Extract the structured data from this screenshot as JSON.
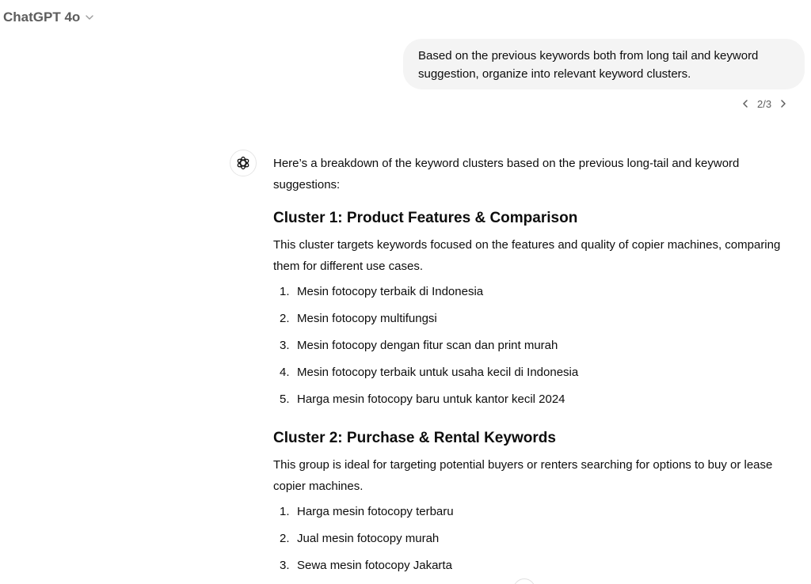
{
  "header": {
    "model_name": "ChatGPT 4o",
    "dropdown_icon": "chevron-down-icon"
  },
  "user_message": {
    "text": "Based on the previous keywords both from long tail and keyword suggestion, organize into relevant keyword clusters."
  },
  "pager": {
    "label": "2/3",
    "prev_icon": "chevron-left-icon",
    "next_icon": "chevron-right-icon"
  },
  "assistant": {
    "avatar_icon": "openai-logo-icon",
    "intro": "Here’s a breakdown of the keyword clusters based on the previous long-tail and keyword suggestions:",
    "clusters": [
      {
        "title": "Cluster 1: Product Features & Comparison",
        "description": "This cluster targets keywords focused on the features and quality of copier machines, comparing them for different use cases.",
        "items": [
          {
            "num": "1.",
            "text": "Mesin fotocopy terbaik di Indonesia"
          },
          {
            "num": "2.",
            "text": "Mesin fotocopy multifungsi"
          },
          {
            "num": "3.",
            "text": "Mesin fotocopy dengan fitur scan dan print murah"
          },
          {
            "num": "4.",
            "text": "Mesin fotocopy terbaik untuk usaha kecil di Indonesia"
          },
          {
            "num": "5.",
            "text": "Harga mesin fotocopy baru untuk kantor kecil 2024"
          }
        ]
      },
      {
        "title": "Cluster 2: Purchase & Rental Keywords",
        "description": "This group is ideal for targeting potential buyers or renters searching for options to buy or lease copier machines.",
        "items": [
          {
            "num": "1.",
            "text": "Harga mesin fotocopy terbaru"
          },
          {
            "num": "2.",
            "text": "Jual mesin fotocopy murah"
          },
          {
            "num": "3.",
            "text": "Sewa mesin fotocopy Jakarta"
          }
        ]
      }
    ]
  },
  "scroll_button": {
    "icon": "arrow-down-icon"
  }
}
